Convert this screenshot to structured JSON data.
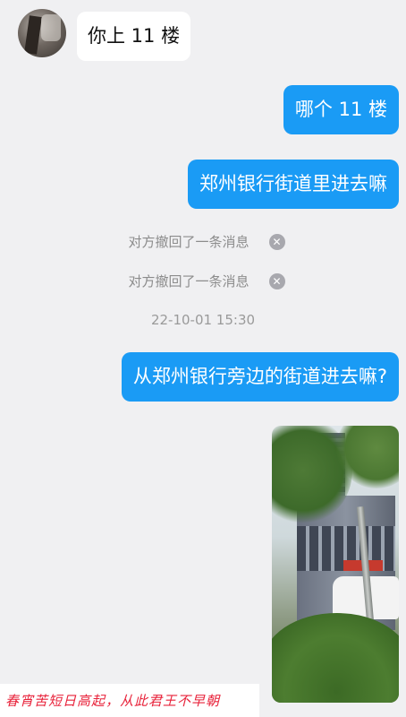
{
  "messages": {
    "incoming_1": "你上 11 楼",
    "outgoing_1": "哪个 11 楼",
    "outgoing_2": "郑州银行街道里进去嘛",
    "outgoing_3": "从郑州银行旁边的街道进去嘛?"
  },
  "system": {
    "recall_1": "对方撤回了一条消息",
    "recall_2": "对方撤回了一条消息",
    "timestamp": "22-10-01 15:30"
  },
  "overlay_caption": "春宵苦短日高起，从此君王不早朝",
  "colors": {
    "background": "#f0f0f2",
    "outgoing_bubble": "#1a9bf5",
    "incoming_bubble": "#ffffff",
    "caption_text": "#e8223a"
  },
  "icons": {
    "recall_close": "close-circle-icon",
    "avatar": "avatar-image"
  }
}
